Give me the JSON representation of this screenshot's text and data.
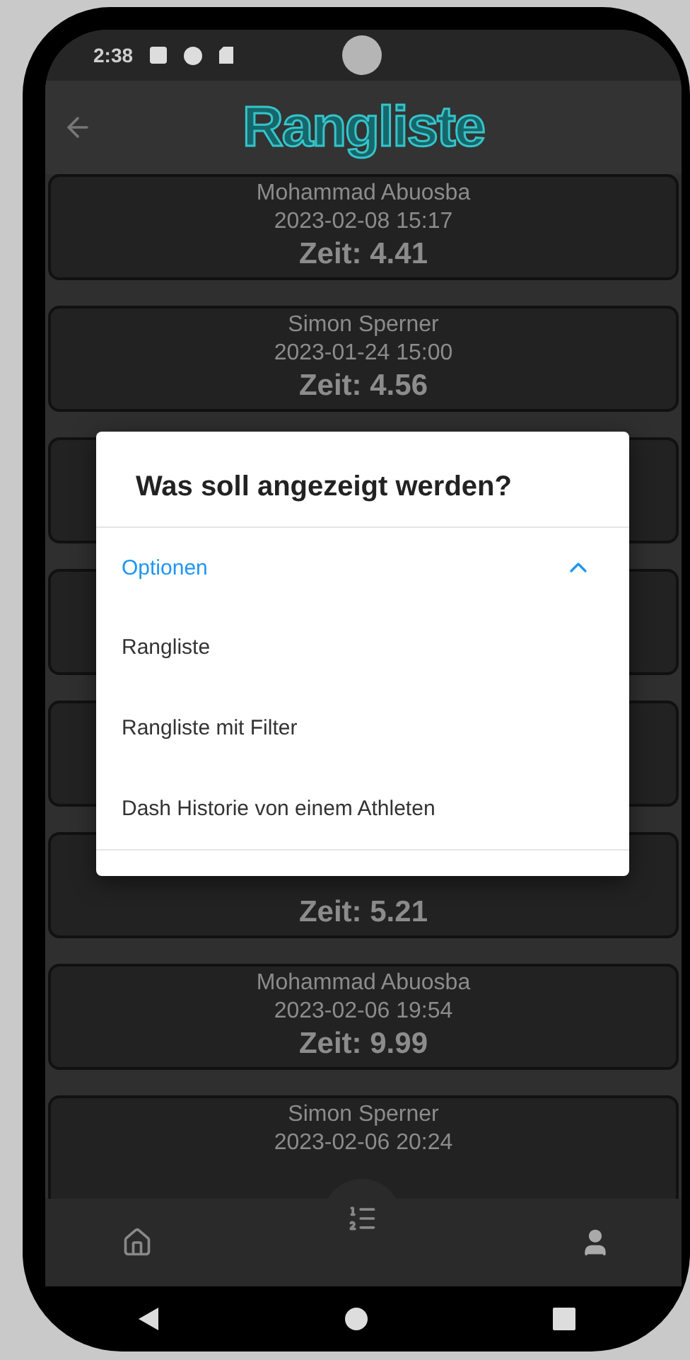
{
  "status_bar": {
    "time": "2:38"
  },
  "app_bar": {
    "title": "Rangliste"
  },
  "entries": [
    {
      "name": "Mohammad Abuosba",
      "date": "2023-02-08 15:17",
      "time": "Zeit: 4.41"
    },
    {
      "name": "Simon Sperner",
      "date": "2023-01-24 15:00",
      "time": "Zeit: 4.56"
    },
    {
      "time": "Zeit: 5.21"
    },
    {
      "name": "Mohammad Abuosba",
      "date": "2023-02-06 19:54",
      "time": "Zeit: 9.99"
    },
    {
      "name": "Simon Sperner",
      "date": "2023-02-06 20:24"
    }
  ],
  "dialog": {
    "title": "Was soll angezeigt werden?",
    "section": {
      "label": "Optionen",
      "expanded": true
    },
    "options": [
      "Rangliste",
      "Rangliste mit Filter",
      "Dash Historie von einem Athleten"
    ]
  }
}
